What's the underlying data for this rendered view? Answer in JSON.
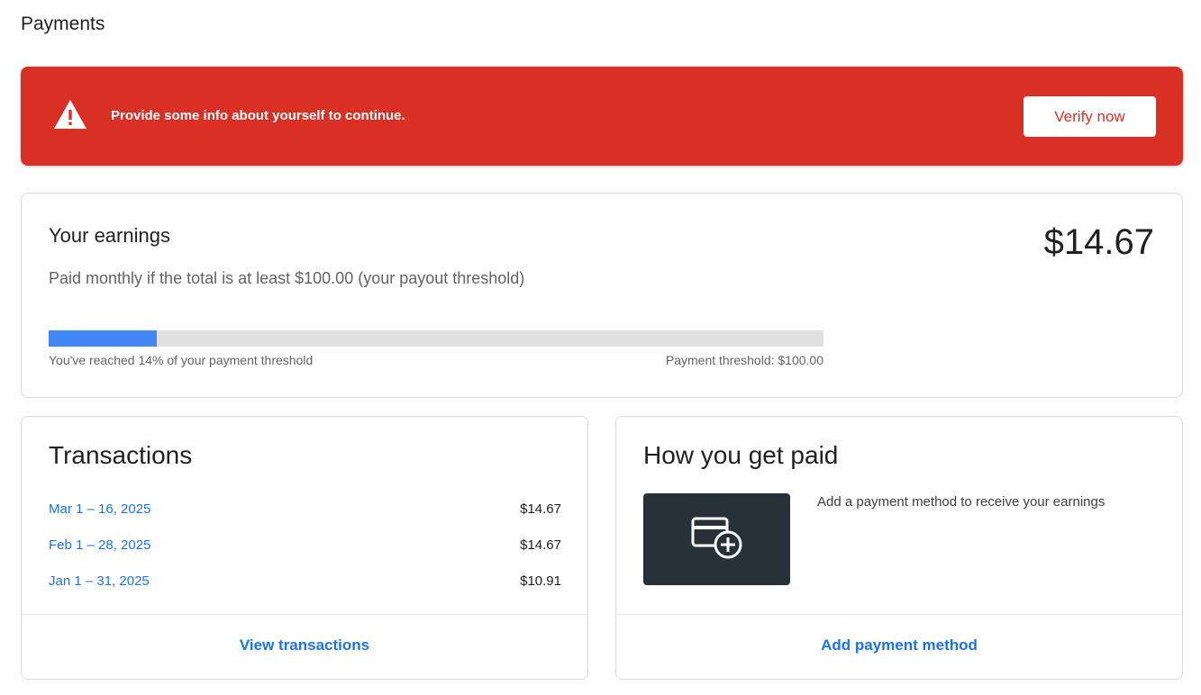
{
  "page": {
    "title": "Payments"
  },
  "alert": {
    "message": "Provide some info about yourself to continue.",
    "icon": "warning-icon",
    "button_label": "Verify now",
    "background_color": "#d93025"
  },
  "earnings": {
    "heading": "Your earnings",
    "amount": "$14.67",
    "subtitle": "Paid monthly if the total is at least $100.00 (your payout threshold)",
    "progress_percent": 14,
    "progress_label": "You've reached 14% of your payment threshold",
    "threshold_label": "Payment threshold: $100.00"
  },
  "transactions": {
    "heading": "Transactions",
    "items": [
      {
        "period": "Mar 1 – 16, 2025",
        "amount": "$14.67"
      },
      {
        "period": "Feb 1 – 28, 2025",
        "amount": "$14.67"
      },
      {
        "period": "Jan 1 – 31, 2025",
        "amount": "$10.91"
      }
    ],
    "footer_link": "View transactions"
  },
  "payment_method": {
    "heading": "How you get paid",
    "description": "Add a payment method to receive your earnings",
    "icon": "add-card-icon",
    "footer_link": "Add payment method"
  },
  "colors": {
    "link": "#1a73e8",
    "progress_fill": "#4285f4",
    "tile_bg": "#263238"
  }
}
